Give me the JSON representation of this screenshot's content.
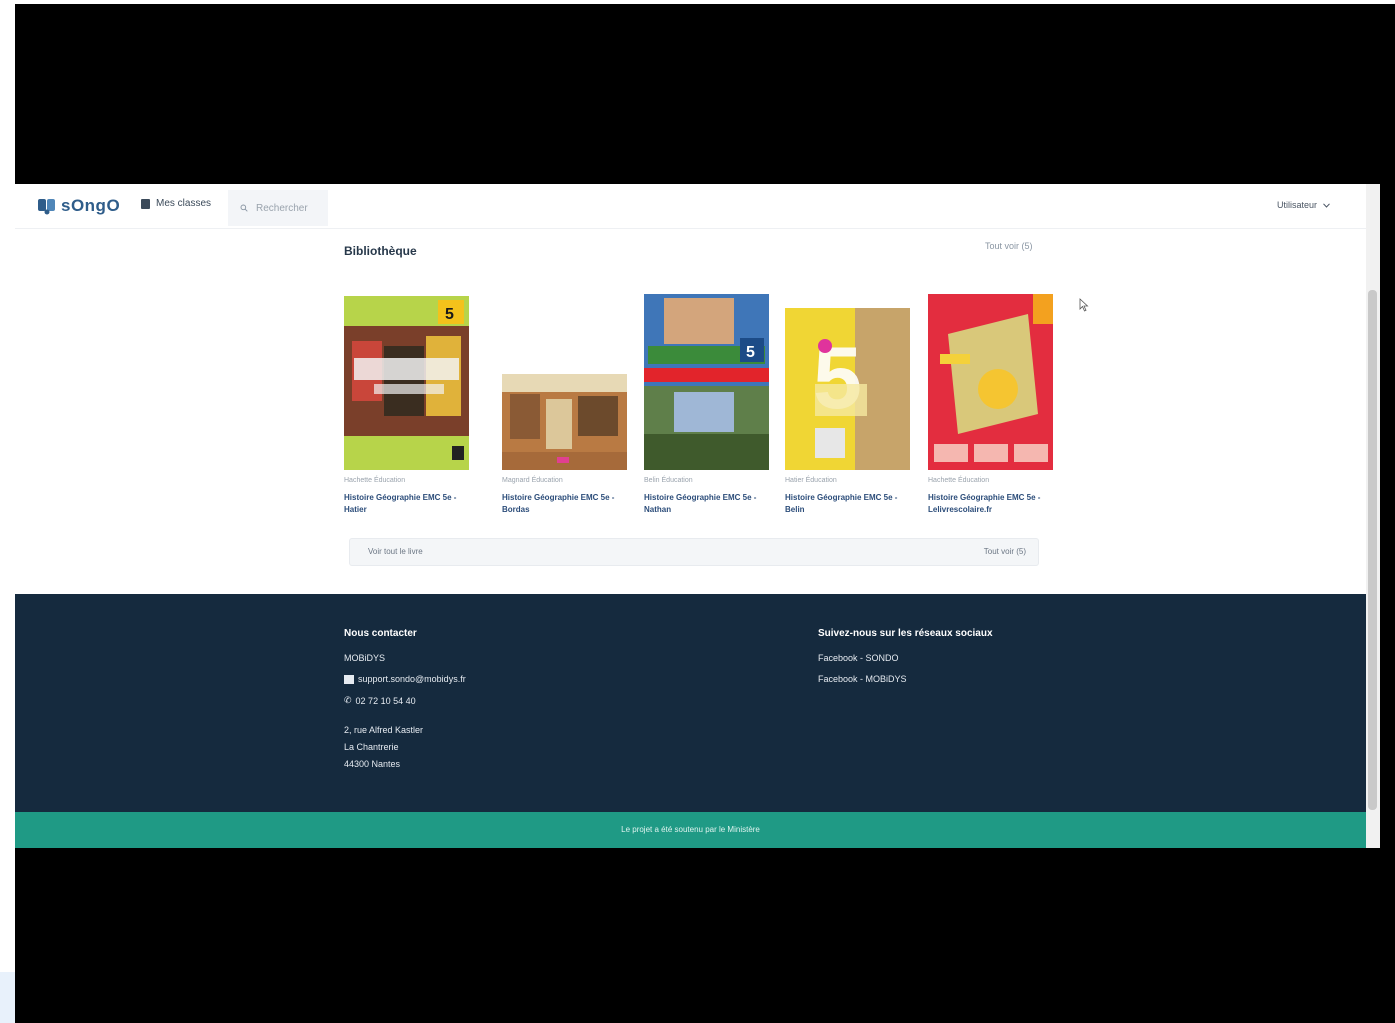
{
  "header": {
    "logo_text": "sOngO",
    "nav_classes_label": "Mes classes",
    "search_placeholder": "Rechercher",
    "user_menu_label": "Utilisateur"
  },
  "library": {
    "title": "Bibliothèque",
    "see_all_label": "Tout voir (5)",
    "summary_left": "Voir tout le livre",
    "summary_right": "Tout voir (5)",
    "books": [
      {
        "publisher": "Hachette Éducation",
        "title": "Histoire Géographie EMC 5e - Hatier",
        "cover": "green-yellow"
      },
      {
        "publisher": "Magnard Éducation",
        "title": "Histoire Géographie EMC 5e - Bordas",
        "cover": "landscape"
      },
      {
        "publisher": "Belin Éducation",
        "title": "Histoire Géographie EMC 5e - Nathan",
        "cover": "blue-photo"
      },
      {
        "publisher": "Hatier Éducation",
        "title": "Histoire Géographie EMC 5e - Belin",
        "cover": "yellow"
      },
      {
        "publisher": "Hachette Éducation",
        "title": "Histoire Géographie EMC 5e - Lelivrescolaire.fr",
        "cover": "red"
      }
    ]
  },
  "footer": {
    "contact_heading": "Nous contacter",
    "company": "MOBiDYS",
    "email": "support.sondo@mobidys.fr",
    "phone": "02 72 10 54 40",
    "address_line1": "2, rue Alfred Kastler",
    "address_line2": "La Chantrerie",
    "address_line3": "44300 Nantes",
    "social_heading": "Suivez-nous sur les réseaux sociaux",
    "social_links": [
      "Facebook - SONDO",
      "Facebook - MOBiDYS"
    ],
    "bottom_text": "Le projet a été soutenu par le Ministère"
  },
  "colors": {
    "footer_bg": "#152a3e",
    "footer_bottom_bg": "#1f9a85",
    "brand": "#2f5d8a"
  }
}
